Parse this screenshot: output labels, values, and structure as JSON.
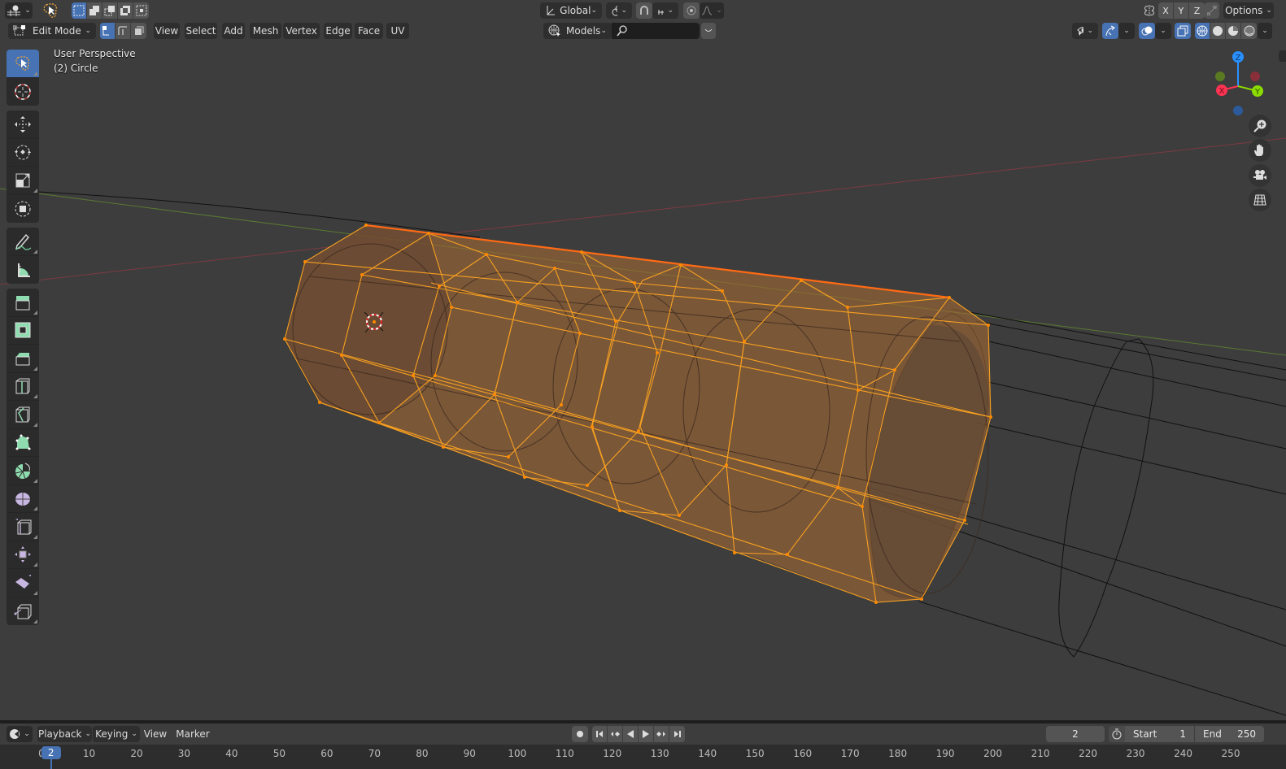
{
  "header1": {
    "editor_type_icon": "view3d-icon",
    "tool_select_icon": "select-lasso-icon",
    "selection_modes": [
      "select-set-icon",
      "select-extend-icon",
      "select-subtract-icon",
      "select-difference-icon",
      "select-intersect-icon"
    ],
    "transform_orientation": "Global",
    "pivot_icon": "pivot-point-icon",
    "snap_icon": "snap-magnet-icon",
    "snap_target_icon": "snap-increment-icon",
    "proportional_icon": "proportional-edit-icon",
    "falloff_icon": "falloff-curve-icon",
    "mirror_icon": "mirror-butterfly-icon",
    "mirror_axes": [
      "X",
      "Y",
      "Z"
    ],
    "auto_merge_icon": "auto-merge-icon",
    "options_label": "Options"
  },
  "header2": {
    "mode": "Edit Mode",
    "select_modes": [
      "vertex",
      "edge",
      "face"
    ],
    "active_select_mode": "vertex",
    "menus": [
      "View",
      "Select",
      "Add",
      "Mesh",
      "Vertex",
      "Edge",
      "Face",
      "UV"
    ],
    "collection_filter": "Models",
    "search_value": "",
    "search_placeholder": ""
  },
  "viewport": {
    "view_name": "User Perspective",
    "object_name": "(2) Circle",
    "gizmo_axes": [
      "X",
      "Y",
      "Z"
    ],
    "axis_colors": {
      "x": "#ff3352",
      "y": "#8bdc00",
      "z": "#2890ff"
    },
    "nav_buttons": [
      "zoom-icon",
      "pan-hand-icon",
      "camera-icon",
      "ortho-grid-icon"
    ],
    "selection_color": "#ffa000",
    "active_edge_color": "#ff6a14"
  },
  "toolbar": {
    "tools": [
      [
        "select-lasso",
        "cursor"
      ],
      [
        "move",
        "rotate",
        "scale",
        "transform"
      ],
      [
        "annotate",
        "measure"
      ],
      [
        "extrude-region",
        "inset-faces",
        "bevel",
        "loop-cut",
        "knife",
        "poly-build",
        "spin",
        "smooth",
        "edge-slide",
        "shrink-fatten",
        "shear",
        "rip-region"
      ]
    ],
    "active_tool": "select-lasso"
  },
  "timeline": {
    "editor_icon": "timeline-clock-icon",
    "menus": [
      "Playback",
      "Keying",
      "View",
      "Marker"
    ],
    "current_frame": "2",
    "start_label": "Start",
    "start_value": "1",
    "end_label": "End",
    "end_value": "250",
    "ruler_ticks": [
      "0",
      "10",
      "20",
      "30",
      "40",
      "50",
      "60",
      "70",
      "80",
      "90",
      "100",
      "110",
      "120",
      "130",
      "140",
      "150",
      "160",
      "170",
      "180",
      "190",
      "200",
      "210",
      "220",
      "230",
      "240",
      "250"
    ],
    "playhead_frame": "2"
  }
}
